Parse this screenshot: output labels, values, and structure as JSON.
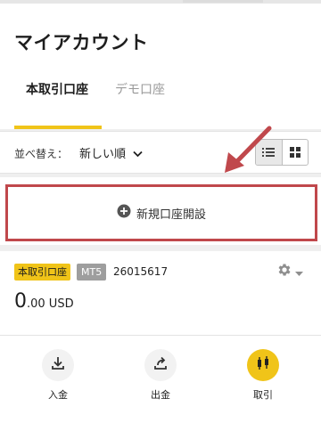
{
  "page": {
    "title": "マイアカウント"
  },
  "tabs": [
    {
      "label": "本取引口座",
      "active": true
    },
    {
      "label": "デモ口座",
      "active": false
    }
  ],
  "sort": {
    "label": "並べ替え：",
    "value": "新しい順",
    "view_modes": [
      "list-icon",
      "grid-icon"
    ],
    "active_view": "list"
  },
  "new_account": {
    "label": "新規口座開設",
    "icon": "plus-circle-icon",
    "highlight_color": "#c0484c"
  },
  "account": {
    "type_badge": "本取引口座",
    "platform_badge": "MT5",
    "number": "26015617",
    "balance_int": "0",
    "balance_dec": ".00 USD",
    "actions": [
      {
        "label": "入金",
        "icon": "download-icon"
      },
      {
        "label": "出金",
        "icon": "upload-icon"
      },
      {
        "label": "取引",
        "icon": "candlestick-icon"
      }
    ]
  },
  "colors": {
    "accent": "#f0c419",
    "annotation": "#c0484c"
  }
}
